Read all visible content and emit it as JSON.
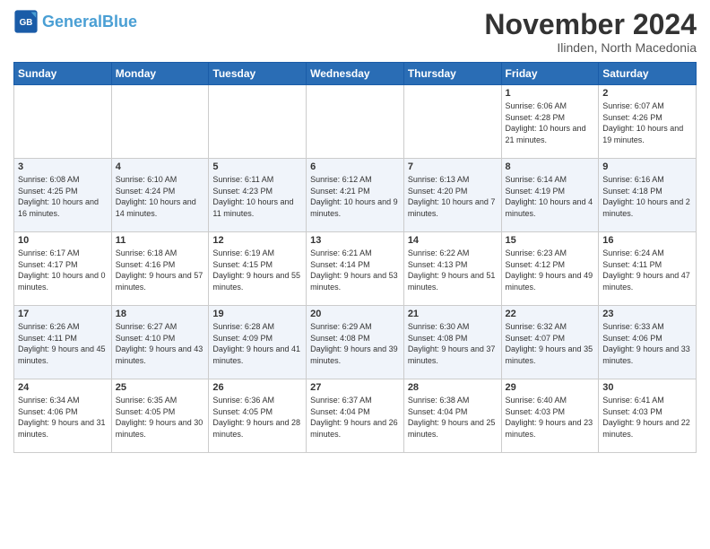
{
  "logo": {
    "general": "General",
    "blue": "Blue"
  },
  "title": "November 2024",
  "location": "Ilinden, North Macedonia",
  "days_of_week": [
    "Sunday",
    "Monday",
    "Tuesday",
    "Wednesday",
    "Thursday",
    "Friday",
    "Saturday"
  ],
  "weeks": [
    [
      {
        "day": "",
        "info": ""
      },
      {
        "day": "",
        "info": ""
      },
      {
        "day": "",
        "info": ""
      },
      {
        "day": "",
        "info": ""
      },
      {
        "day": "",
        "info": ""
      },
      {
        "day": "1",
        "info": "Sunrise: 6:06 AM\nSunset: 4:28 PM\nDaylight: 10 hours and 21 minutes."
      },
      {
        "day": "2",
        "info": "Sunrise: 6:07 AM\nSunset: 4:26 PM\nDaylight: 10 hours and 19 minutes."
      }
    ],
    [
      {
        "day": "3",
        "info": "Sunrise: 6:08 AM\nSunset: 4:25 PM\nDaylight: 10 hours and 16 minutes."
      },
      {
        "day": "4",
        "info": "Sunrise: 6:10 AM\nSunset: 4:24 PM\nDaylight: 10 hours and 14 minutes."
      },
      {
        "day": "5",
        "info": "Sunrise: 6:11 AM\nSunset: 4:23 PM\nDaylight: 10 hours and 11 minutes."
      },
      {
        "day": "6",
        "info": "Sunrise: 6:12 AM\nSunset: 4:21 PM\nDaylight: 10 hours and 9 minutes."
      },
      {
        "day": "7",
        "info": "Sunrise: 6:13 AM\nSunset: 4:20 PM\nDaylight: 10 hours and 7 minutes."
      },
      {
        "day": "8",
        "info": "Sunrise: 6:14 AM\nSunset: 4:19 PM\nDaylight: 10 hours and 4 minutes."
      },
      {
        "day": "9",
        "info": "Sunrise: 6:16 AM\nSunset: 4:18 PM\nDaylight: 10 hours and 2 minutes."
      }
    ],
    [
      {
        "day": "10",
        "info": "Sunrise: 6:17 AM\nSunset: 4:17 PM\nDaylight: 10 hours and 0 minutes."
      },
      {
        "day": "11",
        "info": "Sunrise: 6:18 AM\nSunset: 4:16 PM\nDaylight: 9 hours and 57 minutes."
      },
      {
        "day": "12",
        "info": "Sunrise: 6:19 AM\nSunset: 4:15 PM\nDaylight: 9 hours and 55 minutes."
      },
      {
        "day": "13",
        "info": "Sunrise: 6:21 AM\nSunset: 4:14 PM\nDaylight: 9 hours and 53 minutes."
      },
      {
        "day": "14",
        "info": "Sunrise: 6:22 AM\nSunset: 4:13 PM\nDaylight: 9 hours and 51 minutes."
      },
      {
        "day": "15",
        "info": "Sunrise: 6:23 AM\nSunset: 4:12 PM\nDaylight: 9 hours and 49 minutes."
      },
      {
        "day": "16",
        "info": "Sunrise: 6:24 AM\nSunset: 4:11 PM\nDaylight: 9 hours and 47 minutes."
      }
    ],
    [
      {
        "day": "17",
        "info": "Sunrise: 6:26 AM\nSunset: 4:11 PM\nDaylight: 9 hours and 45 minutes."
      },
      {
        "day": "18",
        "info": "Sunrise: 6:27 AM\nSunset: 4:10 PM\nDaylight: 9 hours and 43 minutes."
      },
      {
        "day": "19",
        "info": "Sunrise: 6:28 AM\nSunset: 4:09 PM\nDaylight: 9 hours and 41 minutes."
      },
      {
        "day": "20",
        "info": "Sunrise: 6:29 AM\nSunset: 4:08 PM\nDaylight: 9 hours and 39 minutes."
      },
      {
        "day": "21",
        "info": "Sunrise: 6:30 AM\nSunset: 4:08 PM\nDaylight: 9 hours and 37 minutes."
      },
      {
        "day": "22",
        "info": "Sunrise: 6:32 AM\nSunset: 4:07 PM\nDaylight: 9 hours and 35 minutes."
      },
      {
        "day": "23",
        "info": "Sunrise: 6:33 AM\nSunset: 4:06 PM\nDaylight: 9 hours and 33 minutes."
      }
    ],
    [
      {
        "day": "24",
        "info": "Sunrise: 6:34 AM\nSunset: 4:06 PM\nDaylight: 9 hours and 31 minutes."
      },
      {
        "day": "25",
        "info": "Sunrise: 6:35 AM\nSunset: 4:05 PM\nDaylight: 9 hours and 30 minutes."
      },
      {
        "day": "26",
        "info": "Sunrise: 6:36 AM\nSunset: 4:05 PM\nDaylight: 9 hours and 28 minutes."
      },
      {
        "day": "27",
        "info": "Sunrise: 6:37 AM\nSunset: 4:04 PM\nDaylight: 9 hours and 26 minutes."
      },
      {
        "day": "28",
        "info": "Sunrise: 6:38 AM\nSunset: 4:04 PM\nDaylight: 9 hours and 25 minutes."
      },
      {
        "day": "29",
        "info": "Sunrise: 6:40 AM\nSunset: 4:03 PM\nDaylight: 9 hours and 23 minutes."
      },
      {
        "day": "30",
        "info": "Sunrise: 6:41 AM\nSunset: 4:03 PM\nDaylight: 9 hours and 22 minutes."
      }
    ]
  ]
}
